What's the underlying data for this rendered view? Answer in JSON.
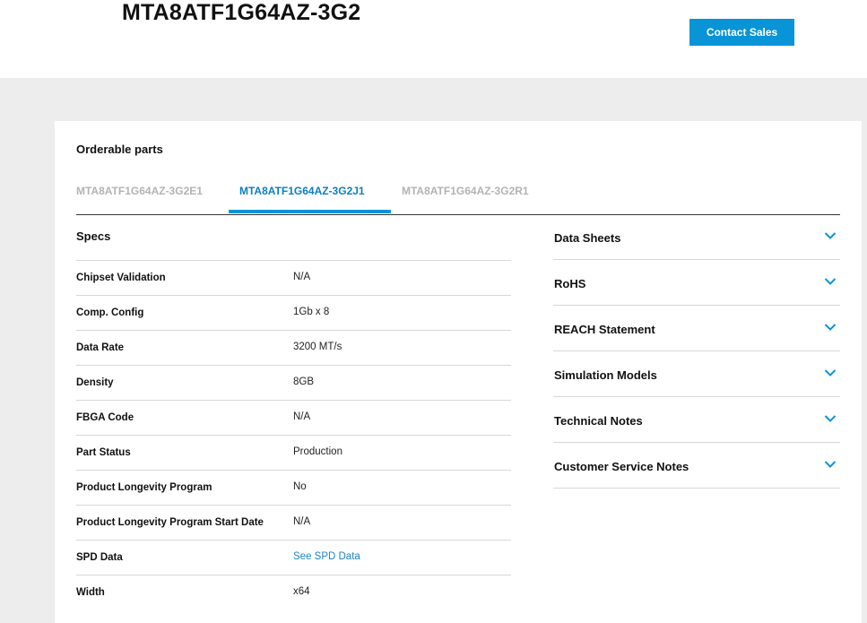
{
  "header": {
    "title": "MTA8ATF1G64AZ-3G2",
    "contact_button": "Contact Sales"
  },
  "orderable": {
    "section_title": "Orderable parts",
    "tabs": [
      {
        "label": "MTA8ATF1G64AZ-3G2E1",
        "active": false
      },
      {
        "label": "MTA8ATF1G64AZ-3G2J1",
        "active": true
      },
      {
        "label": "MTA8ATF1G64AZ-3G2R1",
        "active": false
      }
    ]
  },
  "specs": {
    "heading": "Specs",
    "rows": [
      {
        "label": "Chipset Validation",
        "value": "N/A"
      },
      {
        "label": "Comp. Config",
        "value": "1Gb x 8"
      },
      {
        "label": "Data Rate",
        "value": "3200 MT/s"
      },
      {
        "label": "Density",
        "value": "8GB"
      },
      {
        "label": "FBGA Code",
        "value": "N/A"
      },
      {
        "label": "Part Status",
        "value": "Production"
      },
      {
        "label": "Product Longevity Program",
        "value": "No"
      },
      {
        "label": "Product Longevity Program Start Date",
        "value": "N/A"
      },
      {
        "label": "SPD Data",
        "value": "See SPD Data"
      },
      {
        "label": "Width",
        "value": "x64"
      }
    ]
  },
  "documents": [
    {
      "label": "Data Sheets",
      "icon": "chevron-down-icon"
    },
    {
      "label": "RoHS",
      "icon": "chevron-down-icon"
    },
    {
      "label": "REACH Statement",
      "icon": "chevron-down-icon"
    },
    {
      "label": "Simulation Models",
      "icon": "chevron-down-icon"
    },
    {
      "label": "Technical Notes",
      "icon": "chevron-down-icon"
    },
    {
      "label": "Customer Service Notes",
      "icon": "chevron-down-icon"
    }
  ],
  "colors": {
    "accent": "#0a94d8",
    "link": "#1a86c8",
    "inactive_tab": "#b3b3b3",
    "page_bg": "#ededed"
  }
}
